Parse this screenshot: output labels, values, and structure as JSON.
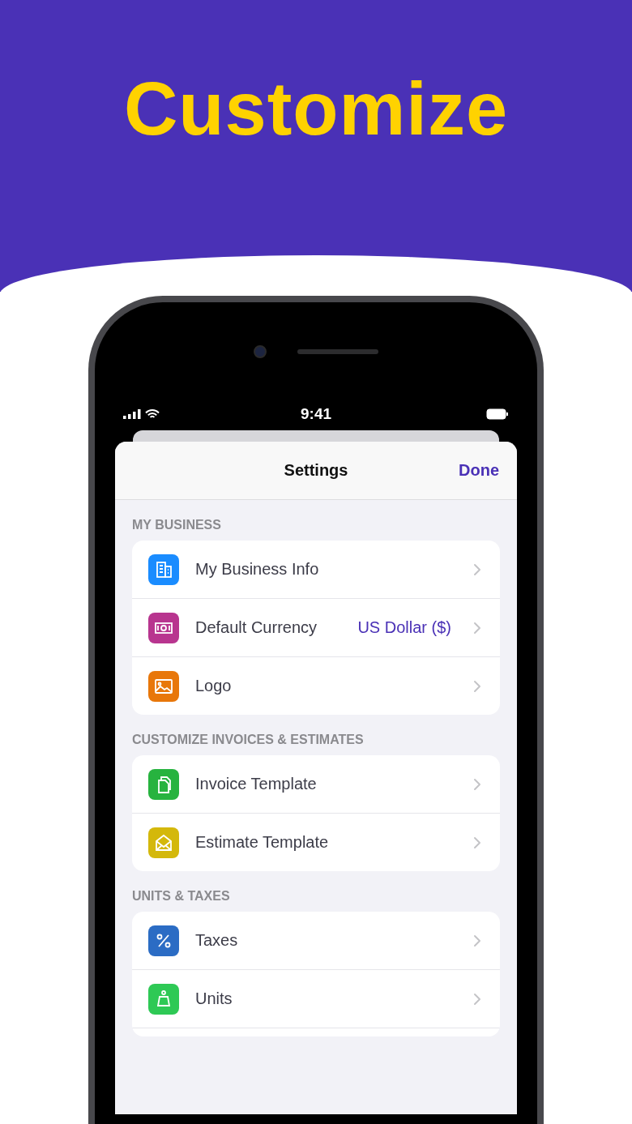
{
  "headline": "Customize",
  "status_bar": {
    "time": "9:41"
  },
  "nav": {
    "title": "Settings",
    "done": "Done"
  },
  "sections": [
    {
      "title": "MY BUSINESS",
      "truncated": false,
      "rows": [
        {
          "kind": "building",
          "color": "#1a8cff",
          "label": "My Business Info"
        },
        {
          "kind": "currency",
          "color": "#b8358f",
          "label": "Default Currency",
          "value": "US Dollar ($)"
        },
        {
          "kind": "image",
          "color": "#e8770a",
          "label": "Logo"
        }
      ]
    },
    {
      "title": "CUSTOMIZE INVOICES & ESTIMATES",
      "truncated": false,
      "rows": [
        {
          "kind": "document",
          "color": "#27b33f",
          "label": "Invoice Template"
        },
        {
          "kind": "envelope",
          "color": "#d4b80b",
          "label": "Estimate Template"
        }
      ]
    },
    {
      "title": "UNITS & TAXES",
      "truncated": true,
      "rows": [
        {
          "kind": "percent",
          "color": "#2b6cc4",
          "label": "Taxes"
        },
        {
          "kind": "weight",
          "color": "#2ec955",
          "label": "Units"
        }
      ]
    }
  ]
}
